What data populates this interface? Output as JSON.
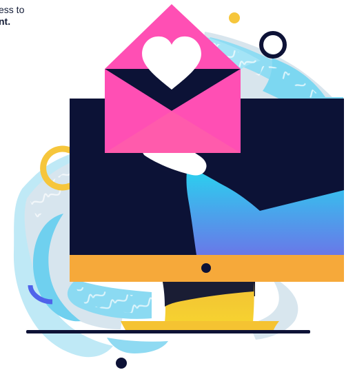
{
  "caption": {
    "line1": "ess to",
    "line2": "nt."
  },
  "illustration": {
    "icon_names": [
      "desktop-monitor-icon",
      "envelope-heart-icon",
      "hand-icon"
    ],
    "colors": {
      "navy": "#0d1236",
      "pink": "#ff4fb4",
      "orange": "#f7a935",
      "yellow": "#f6c742",
      "cyan": "#2bd1ef",
      "blue": "#6376e8",
      "paint_blue": "#8fdaf1",
      "paint_gray": "#d9e3eb"
    }
  }
}
